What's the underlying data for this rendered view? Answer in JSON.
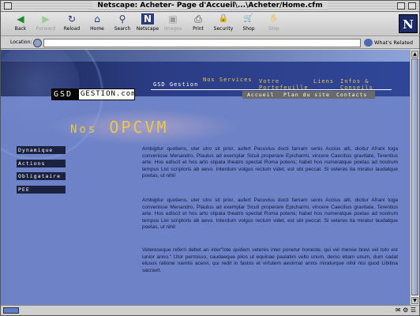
{
  "window": {
    "title": "Netscape: Acheter- Page d'Accueil\\...\\Acheter/Home.cfm"
  },
  "toolbar": {
    "buttons": [
      {
        "label": "Back",
        "icon": "◀",
        "enabled": true
      },
      {
        "label": "Forward",
        "icon": "▶",
        "enabled": false
      },
      {
        "label": "Reload",
        "icon": "↻",
        "enabled": true
      },
      {
        "label": "Home",
        "icon": "⌂",
        "enabled": true
      },
      {
        "label": "Search",
        "icon": "⚲",
        "enabled": true
      },
      {
        "label": "Netscape",
        "icon": "N",
        "enabled": true
      },
      {
        "label": "Images",
        "icon": "▣",
        "enabled": false
      },
      {
        "label": "Print",
        "icon": "⎙",
        "enabled": true
      },
      {
        "label": "Security",
        "icon": "🔒",
        "enabled": true
      },
      {
        "label": "Shop",
        "icon": "🛒",
        "enabled": true
      },
      {
        "label": "Stop",
        "icon": "✋",
        "enabled": false
      }
    ],
    "logo": "N"
  },
  "location": {
    "label": "Location:",
    "value": "",
    "related": "What's Related"
  },
  "site": {
    "logo_gsd": "GSD",
    "logo_gestion": "GESTION.com",
    "nav_top": {
      "gsd_gestion": "GSD Gestion",
      "nos_services": "Nos Services",
      "votre": "Votre",
      "portefeuille": "Portefeuille",
      "liens": "Liens",
      "infos": "Infos &",
      "conseils": "Conseils"
    },
    "nav_sub": {
      "accueil": "Accueil",
      "plan": "Plan du site",
      "contacts": "Contacts"
    },
    "page_title_small": "Nos",
    "page_title": "OPCVM",
    "menu": [
      "Dynamique",
      "Actions",
      "Obligataire",
      "PEE"
    ],
    "paragraphs": [
      "Ambigitur quotiens, uter utro sit prior, aufert Pacuvius docti famam senis Accius alti, dicitur Afrani toga convenisse Menandro, Plautus ad exemplar Siculi properare Epicharmi, vincere Caecilius gravitate, Terentius arte. Hos ediscit et hos arto stipata theatro spectat Roma potens; habet hos numeratque poetas ad nostrum tempus Livi scriptoris ab aevo. Interdum volgus rectum videt, est ubi peccat. Si veteres ita miratur laudatque poetas, ut nihil",
      "Ambigitur quotiens, uter utro sit prior, aufert Pacuvius docti famam senis Accius alti, dicitur Afrani toga convenisse Menandro, Plautus ad exemplar Siculi properare Epicharmi, vincere Caecilius gravitate, Terentius arte. Hos ediscit et hos arto stipata theatro spectat Roma potens; habet hos numeratque poetas ad nostrum tempus Livi scriptoris ab aevo. Interdum volgus rectum videt, est ubi peccat. Si veteres ita miratur laudatque poetas, ut nihil",
      "Vetereseque referri debet an inter\"lote quidem veteres inter ponetur honeste, qui vel mense brevi vel toto est iunior anno.\" Utor permisso, caudaeque pilos ut equinae paulatim vello unum, demo etiam unum, dum cadat elusus ratione ruentis acervi, qui redit in fastos et virtutem aestimat annis miraturque nihil nisi quod Libitina sacravit."
    ]
  }
}
